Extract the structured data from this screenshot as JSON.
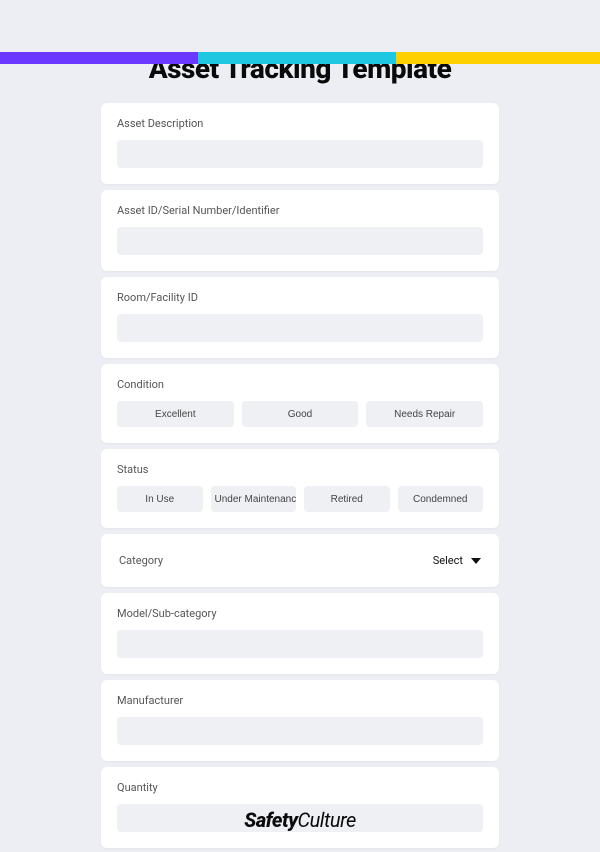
{
  "title": "Asset Tracking Template",
  "fields": {
    "asset_description": {
      "label": "Asset Description",
      "value": ""
    },
    "asset_id": {
      "label": "Asset ID/Serial Number/Identifier",
      "value": ""
    },
    "room_id": {
      "label": "Room/Facility ID",
      "value": ""
    },
    "condition": {
      "label": "Condition",
      "options": [
        "Excellent",
        "Good",
        "Needs Repair"
      ]
    },
    "status": {
      "label": "Status",
      "options": [
        "In Use",
        "Under Maintenance",
        "Retired",
        "Condemned"
      ]
    },
    "category": {
      "label": "Category",
      "select_text": "Select"
    },
    "model": {
      "label": "Model/Sub-category",
      "value": ""
    },
    "manufacturer": {
      "label": "Manufacturer",
      "value": ""
    },
    "quantity": {
      "label": "Quantity",
      "value": ""
    }
  },
  "brand": {
    "bold": "Safety",
    "light": "Culture"
  },
  "colors": {
    "purple": "#6a38ff",
    "cyan": "#1fc7e0",
    "yellow": "#ffd000",
    "page_bg": "#eceef4",
    "input_bg": "#eef0f4"
  }
}
